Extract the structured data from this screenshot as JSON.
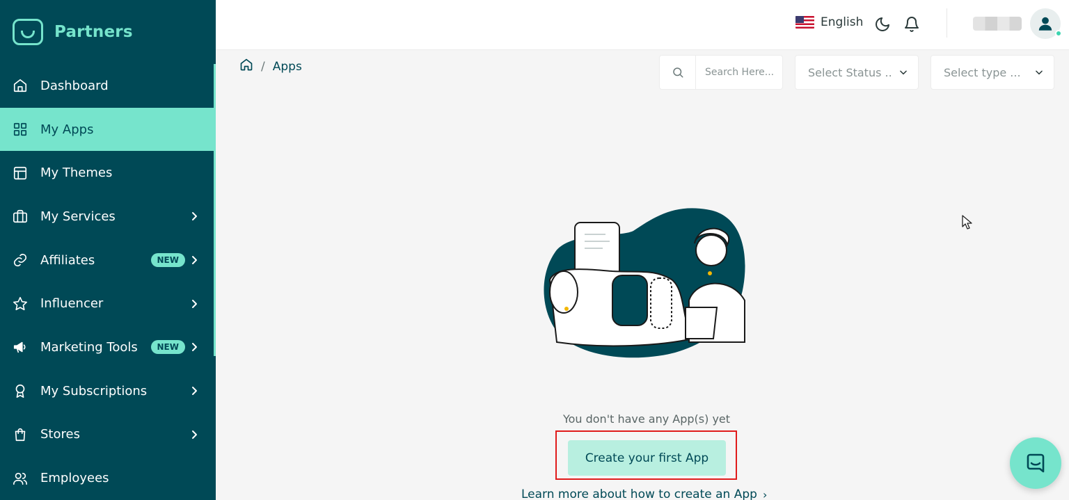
{
  "brand": {
    "name": "Partners",
    "accent": "#76e4cc",
    "primary": "#004956"
  },
  "sidebar": {
    "items": [
      {
        "label": "Dashboard",
        "icon": "home-icon",
        "badge": "",
        "has_chevron": false,
        "active": false
      },
      {
        "label": "My Apps",
        "icon": "grid-icon",
        "badge": "",
        "has_chevron": false,
        "active": true
      },
      {
        "label": "My Themes",
        "icon": "layout-icon",
        "badge": "",
        "has_chevron": false,
        "active": false
      },
      {
        "label": "My Services",
        "icon": "briefcase-icon",
        "badge": "",
        "has_chevron": true,
        "active": false
      },
      {
        "label": "Affiliates",
        "icon": "link-icon",
        "badge": "NEW",
        "has_chevron": true,
        "active": false
      },
      {
        "label": "Influencer",
        "icon": "star-icon",
        "badge": "",
        "has_chevron": true,
        "active": false
      },
      {
        "label": "Marketing Tools",
        "icon": "megaphone-icon",
        "badge": "NEW",
        "has_chevron": true,
        "active": false
      },
      {
        "label": "My Subscriptions",
        "icon": "award-icon",
        "badge": "",
        "has_chevron": true,
        "active": false
      },
      {
        "label": "Stores",
        "icon": "shopping-bag-icon",
        "badge": "",
        "has_chevron": true,
        "active": false
      },
      {
        "label": "Employees",
        "icon": "users-icon",
        "badge": "",
        "has_chevron": false,
        "active": false
      }
    ]
  },
  "header": {
    "language": "English",
    "language_flag": "us-flag-icon",
    "theme_toggle_icon": "moon-icon",
    "notifications_icon": "bell-icon",
    "avatar_icon": "user-icon"
  },
  "breadcrumb": {
    "home_icon": "home-icon",
    "separator": "/",
    "current": "Apps"
  },
  "filters": {
    "search_placeholder": "Search Here...",
    "status_placeholder": "Select Status ..",
    "type_placeholder": "Select type ..."
  },
  "empty_state": {
    "message": "You don't have any App(s) yet",
    "cta_label": "Create your first App",
    "learn_more": "Learn more about how to create an App",
    "learn_more_arrow": "›"
  },
  "chat": {
    "icon": "chat-icon"
  }
}
